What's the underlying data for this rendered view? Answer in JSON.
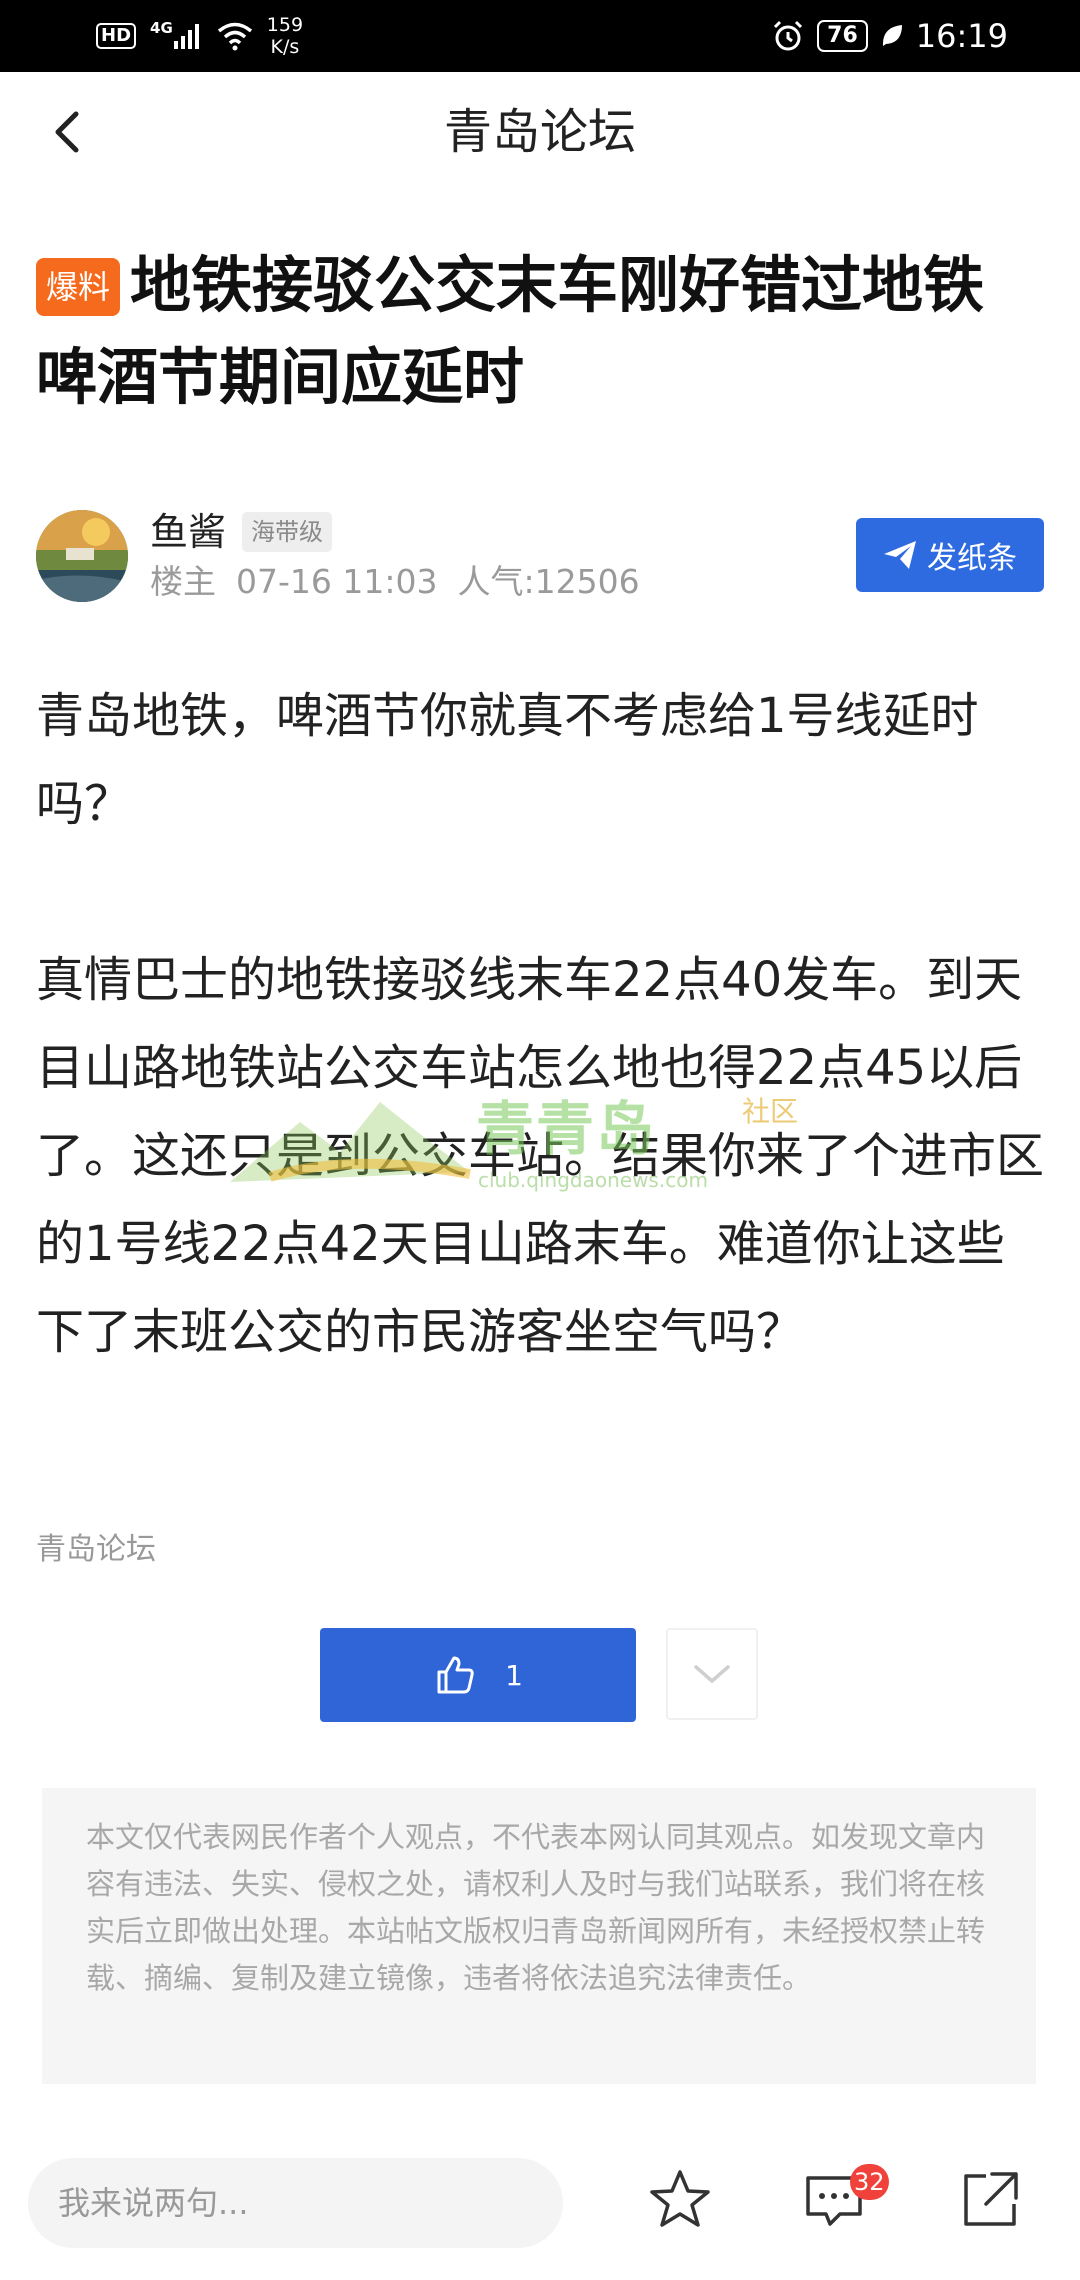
{
  "status_bar": {
    "hd_label": "HD",
    "network_label": "4G",
    "speed_value": "159",
    "speed_unit": "K/s",
    "battery": "76",
    "time": "16:19"
  },
  "nav": {
    "title": "青岛论坛",
    "back_icon": "back-chevron-icon"
  },
  "post": {
    "tag": "爆料",
    "tag_color": "#f56a1d",
    "title": "地铁接驳公交末车刚好错过地铁 啤酒节期间应延时",
    "author": {
      "name": "鱼酱",
      "level": "海带级",
      "role": "楼主",
      "date": "07-16 11:03",
      "popularity": "人气:12506"
    },
    "send_note_label": "发纸条",
    "paragraphs": [
      "青岛地铁，啤酒节你就真不考虑给1号线延时吗？",
      "真情巴士的地铁接驳线末车22点40发车。到天目山路地铁站公交车站怎么地也得22点45以后了。这还只是到公交车站。结果你来了个进市区的1号线22点42天目山路末车。难道你让这些下了末班公交的市民游客坐空气吗？"
    ],
    "watermark": {
      "brand": "青青岛",
      "sub": "社区",
      "url": "club.qingdaonews.com"
    },
    "source": "青岛论坛",
    "like_count": "1"
  },
  "disclaimer": "本文仅代表网民作者个人观点，不代表本网认同其观点。如发现文章内容有违法、失实、侵权之处，请权利人及时与我们站联系，我们将在核实后立即做出处理。本站帖文版权归青岛新闻网所有，未经授权禁止转载、摘编、复制及建立镜像，违者将依法追究法律责任。",
  "bottom_bar": {
    "comment_placeholder": "我来说两句...",
    "comment_count": "32"
  },
  "colors": {
    "accent_blue": "#2f65d6",
    "badge_red": "#f0413a"
  }
}
